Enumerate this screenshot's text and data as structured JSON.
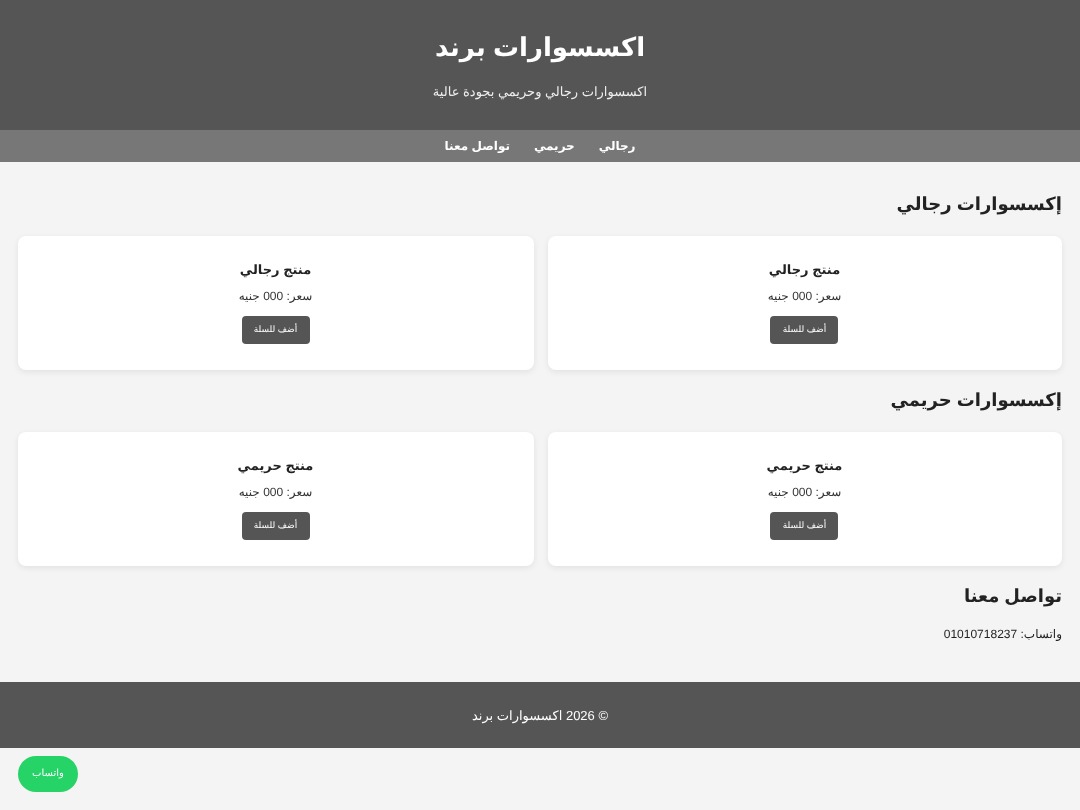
{
  "header": {
    "title": "اكسسوارات برند",
    "subtitle": "اكسسوارات رجالي وحريمي بجودة عالية"
  },
  "nav": [
    "رجالي",
    "حريمي",
    "تواصل معنا"
  ],
  "sections": [
    {
      "heading": "إكسسوارات رجالي",
      "products": [
        {
          "name": "منتج رجالي",
          "price": "سعر: 000 جنيه",
          "button": "أضف للسلة"
        },
        {
          "name": "منتج رجالي",
          "price": "سعر: 000 جنيه",
          "button": "أضف للسلة"
        }
      ]
    },
    {
      "heading": "إكسسوارات حريمي",
      "products": [
        {
          "name": "منتج حريمي",
          "price": "سعر: 000 جنيه",
          "button": "أضف للسلة"
        },
        {
          "name": "منتج حريمي",
          "price": "سعر: 000 جنيه",
          "button": "أضف للسلة"
        }
      ]
    }
  ],
  "contact": {
    "heading": "تواصل معنا",
    "whatsapp": "واتساب: 01010718237"
  },
  "footer": "© 2026 اكسسوارات برند",
  "whatsapp_button": "واتساب"
}
